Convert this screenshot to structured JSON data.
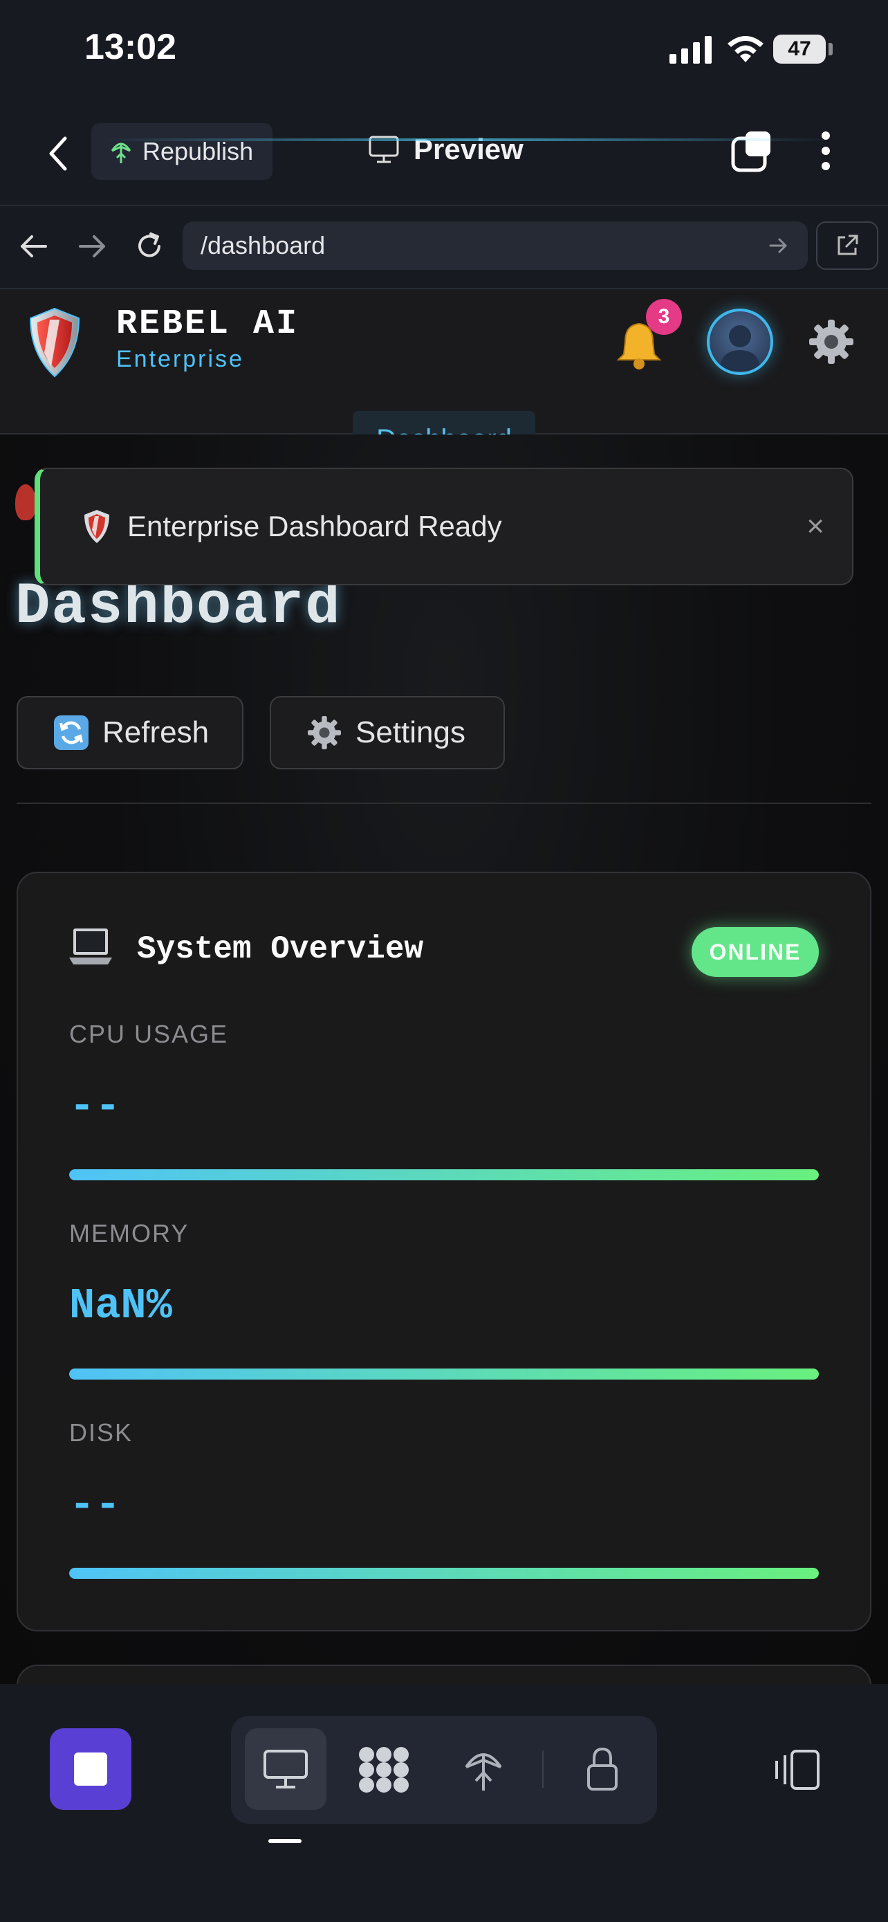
{
  "status_bar": {
    "time": "13:02",
    "battery": "47"
  },
  "app_toolbar": {
    "republish_label": "Republish",
    "preview_label": "Preview"
  },
  "browser": {
    "url": "/dashboard"
  },
  "site_header": {
    "brand_name": "REBEL AI",
    "brand_sub": "Enterprise",
    "notification_count": "3",
    "nav_tab": "Dashboard"
  },
  "toast": {
    "message": "Enterprise Dashboard Ready",
    "close": "×"
  },
  "page": {
    "title": "Dashboard",
    "buttons": {
      "refresh": "Refresh",
      "settings": "Settings"
    }
  },
  "system_card": {
    "title": "System Overview",
    "status": "ONLINE",
    "metrics": [
      {
        "label": "CPU USAGE",
        "value": "--",
        "fill": 1.0
      },
      {
        "label": "MEMORY",
        "value": "NaN%",
        "fill": 1.0
      },
      {
        "label": "DISK",
        "value": "--",
        "fill": 1.0
      }
    ]
  },
  "colors": {
    "accent_blue": "#4fc3f7",
    "accent_green": "#63e58a",
    "badge_pink": "#e53a86",
    "stop_purple": "#5a3fd4"
  }
}
